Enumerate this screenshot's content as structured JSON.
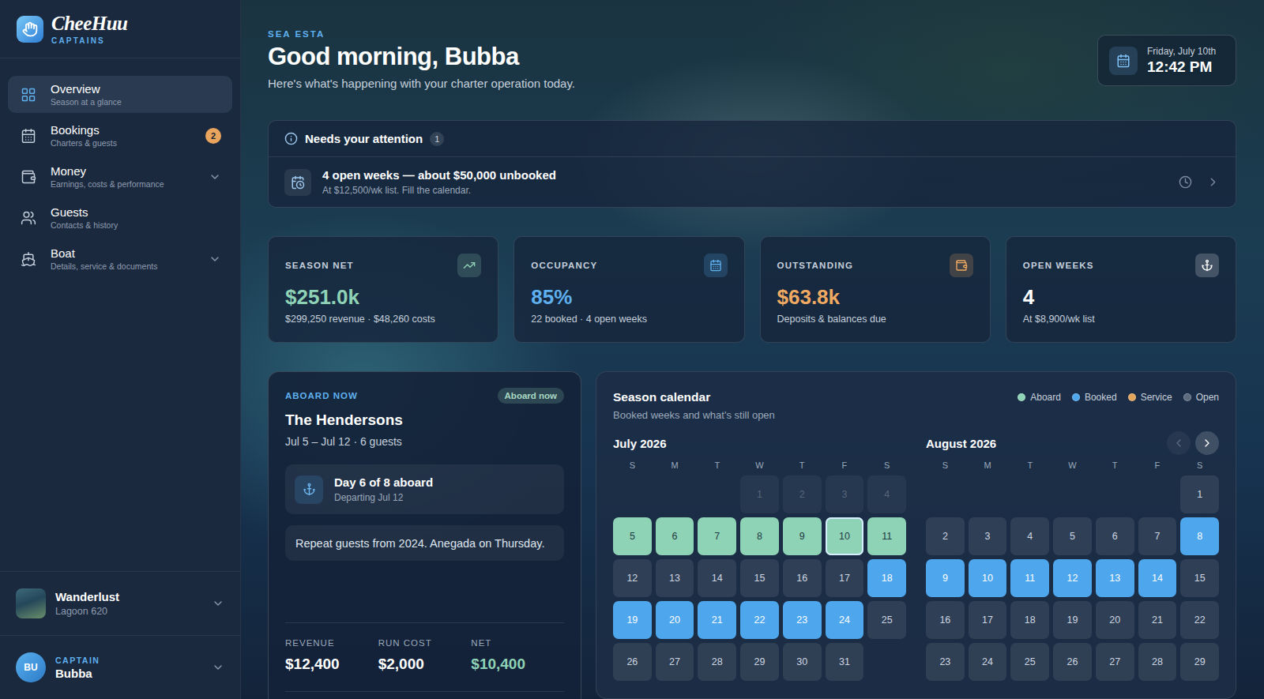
{
  "brand": {
    "name": "CheeHuu",
    "tagline": "CAPTAINS"
  },
  "nav": [
    {
      "label": "Overview",
      "sub": "Season at a glance",
      "selected": true,
      "expandable": false
    },
    {
      "label": "Bookings",
      "sub": "Charters & guests",
      "selected": false,
      "expandable": false,
      "badge": "2"
    },
    {
      "label": "Money",
      "sub": "Earnings, costs & performance",
      "selected": false,
      "expandable": true
    },
    {
      "label": "Guests",
      "sub": "Contacts & history",
      "selected": false,
      "expandable": false
    },
    {
      "label": "Boat",
      "sub": "Details, service & documents",
      "selected": false,
      "expandable": true
    }
  ],
  "boat": {
    "name": "Wanderlust",
    "model": "Lagoon 620"
  },
  "captain": {
    "initials": "BU",
    "role": "CAPTAIN",
    "name": "Bubba"
  },
  "header": {
    "eyebrow": "SEA ESTA",
    "greeting": "Good morning, Bubba",
    "subtitle": "Here's what's happening with your charter operation today."
  },
  "clock": {
    "date": "Friday, July 10th",
    "time": "12:42 PM"
  },
  "attention": {
    "title": "Needs your attention",
    "count": "1",
    "items": [
      {
        "title": "4 open weeks — about $50,000 unbooked",
        "sub": "At $12,500/wk list. Fill the calendar."
      }
    ]
  },
  "stats": [
    {
      "label": "SEASON NET",
      "value": "$251.0k",
      "sub": "$299,250 revenue · $48,260 costs",
      "color": "#8fd3b6"
    },
    {
      "label": "OCCUPANCY",
      "value": "85%",
      "sub": "22 booked · 4 open weeks",
      "color": "#5fb0ee"
    },
    {
      "label": "OUTSTANDING",
      "value": "$63.8k",
      "sub": "Deposits & balances due",
      "color": "#f0aa62"
    },
    {
      "label": "OPEN WEEKS",
      "value": "4",
      "sub": "At $8,900/wk list",
      "color": "#ffffff"
    }
  ],
  "aboard": {
    "eyebrow": "ABOARD NOW",
    "badge": "Aboard now",
    "name": "The Hendersons",
    "dates": "Jul 5 – Jul 12 · 6 guests",
    "progress_title": "Day 6 of 8 aboard",
    "progress_sub": "Departing Jul 12",
    "note": "Repeat guests from 2024. Anegada on Thursday.",
    "figures": [
      {
        "label": "REVENUE",
        "value": "$12,400",
        "color": "#ffffff"
      },
      {
        "label": "RUN COST",
        "value": "$2,000",
        "color": "#ffffff"
      },
      {
        "label": "NET",
        "value": "$10,400",
        "color": "#8fd3b6"
      }
    ]
  },
  "calendar": {
    "title": "Season calendar",
    "subtitle": "Booked weeks and what's still open",
    "legend": [
      {
        "key": "aboard",
        "label": "Aboard",
        "color": "#8fd3b6"
      },
      {
        "key": "booked",
        "label": "Booked",
        "color": "#4ea6ec"
      },
      {
        "key": "service",
        "label": "Service",
        "color": "#e3a55b"
      },
      {
        "key": "open",
        "label": "Open",
        "color": "#5d6b7e"
      }
    ],
    "weekdays": [
      "S",
      "M",
      "T",
      "W",
      "T",
      "F",
      "S"
    ],
    "prev_enabled": false,
    "next_enabled": true,
    "months": [
      {
        "title": "July 2026",
        "leading_blanks": 3,
        "days": [
          {
            "day": "1",
            "status": "past",
            "today": false
          },
          {
            "day": "2",
            "status": "past",
            "today": false
          },
          {
            "day": "3",
            "status": "past",
            "today": false
          },
          {
            "day": "4",
            "status": "past",
            "today": false
          },
          {
            "day": "5",
            "status": "aboard",
            "today": false
          },
          {
            "day": "6",
            "status": "aboard",
            "today": false
          },
          {
            "day": "7",
            "status": "aboard",
            "today": false
          },
          {
            "day": "8",
            "status": "aboard",
            "today": false
          },
          {
            "day": "9",
            "status": "aboard",
            "today": false
          },
          {
            "day": "10",
            "status": "aboard",
            "today": true
          },
          {
            "day": "11",
            "status": "aboard",
            "today": false
          },
          {
            "day": "12",
            "status": "open",
            "today": false
          },
          {
            "day": "13",
            "status": "open",
            "today": false
          },
          {
            "day": "14",
            "status": "open",
            "today": false
          },
          {
            "day": "15",
            "status": "open",
            "today": false
          },
          {
            "day": "16",
            "status": "open",
            "today": false
          },
          {
            "day": "17",
            "status": "open",
            "today": false
          },
          {
            "day": "18",
            "status": "booked",
            "today": false
          },
          {
            "day": "19",
            "status": "booked",
            "today": false
          },
          {
            "day": "20",
            "status": "booked",
            "today": false
          },
          {
            "day": "21",
            "status": "booked",
            "today": false
          },
          {
            "day": "22",
            "status": "booked",
            "today": false
          },
          {
            "day": "23",
            "status": "booked",
            "today": false
          },
          {
            "day": "24",
            "status": "booked",
            "today": false
          },
          {
            "day": "25",
            "status": "open",
            "today": false
          },
          {
            "day": "26",
            "status": "open",
            "today": false
          },
          {
            "day": "27",
            "status": "open",
            "today": false
          },
          {
            "day": "28",
            "status": "open",
            "today": false
          },
          {
            "day": "29",
            "status": "open",
            "today": false
          },
          {
            "day": "30",
            "status": "open",
            "today": false
          },
          {
            "day": "31",
            "status": "open",
            "today": false
          }
        ]
      },
      {
        "title": "August 2026",
        "leading_blanks": 6,
        "days": [
          {
            "day": "1",
            "status": "open",
            "today": false
          },
          {
            "day": "2",
            "status": "open",
            "today": false
          },
          {
            "day": "3",
            "status": "open",
            "today": false
          },
          {
            "day": "4",
            "status": "open",
            "today": false
          },
          {
            "day": "5",
            "status": "open",
            "today": false
          },
          {
            "day": "6",
            "status": "open",
            "today": false
          },
          {
            "day": "7",
            "status": "open",
            "today": false
          },
          {
            "day": "8",
            "status": "booked",
            "today": false
          },
          {
            "day": "9",
            "status": "booked",
            "today": false
          },
          {
            "day": "10",
            "status": "booked",
            "today": false
          },
          {
            "day": "11",
            "status": "booked",
            "today": false
          },
          {
            "day": "12",
            "status": "booked",
            "today": false
          },
          {
            "day": "13",
            "status": "booked",
            "today": false
          },
          {
            "day": "14",
            "status": "booked",
            "today": false
          },
          {
            "day": "15",
            "status": "open",
            "today": false
          },
          {
            "day": "16",
            "status": "open",
            "today": false
          },
          {
            "day": "17",
            "status": "open",
            "today": false
          },
          {
            "day": "18",
            "status": "open",
            "today": false
          },
          {
            "day": "19",
            "status": "open",
            "today": false
          },
          {
            "day": "20",
            "status": "open",
            "today": false
          },
          {
            "day": "21",
            "status": "open",
            "today": false
          },
          {
            "day": "22",
            "status": "open",
            "today": false
          },
          {
            "day": "23",
            "status": "open",
            "today": false
          },
          {
            "day": "24",
            "status": "open",
            "today": false
          },
          {
            "day": "25",
            "status": "open",
            "today": false
          },
          {
            "day": "26",
            "status": "open",
            "today": false
          },
          {
            "day": "27",
            "status": "open",
            "today": false
          },
          {
            "day": "28",
            "status": "open",
            "today": false
          },
          {
            "day": "29",
            "status": "open",
            "today": false
          }
        ]
      }
    ]
  }
}
